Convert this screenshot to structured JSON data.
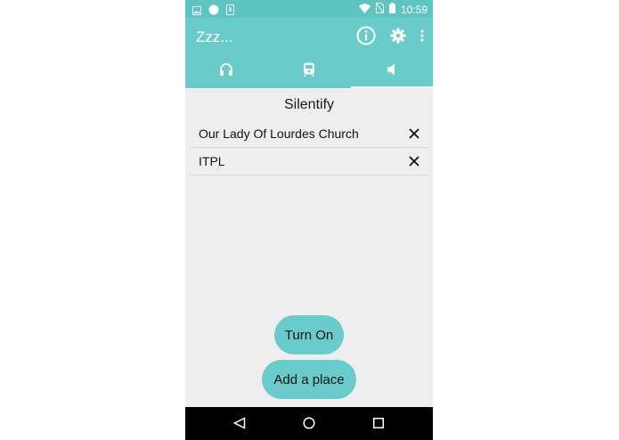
{
  "status_bar": {
    "time": "10:59",
    "icons": [
      "image-icon",
      "circle-icon",
      "phone-icon",
      "wifi-icon",
      "no-sim-icon",
      "battery-icon"
    ]
  },
  "app_bar": {
    "title": "Zzz...",
    "actions": [
      "info-icon",
      "gear-icon",
      "more-vert-icon"
    ]
  },
  "tabs": [
    {
      "icon": "headphones-icon",
      "selected": false
    },
    {
      "icon": "train-icon",
      "selected": false
    },
    {
      "icon": "volume-icon",
      "selected": true
    }
  ],
  "main": {
    "section_title": "Silentify",
    "places": [
      {
        "name": "Our Lady Of Lourdes Church"
      },
      {
        "name": "ITPL"
      }
    ],
    "turn_on_label": "Turn On",
    "add_place_label": "Add a place"
  },
  "nav_bar": {
    "items": [
      "back-icon",
      "home-icon",
      "recents-icon"
    ]
  },
  "colors": {
    "accent": "#6accca",
    "status_bar": "#5ec4c0",
    "background": "#eeeeee",
    "nav": "#000000"
  }
}
